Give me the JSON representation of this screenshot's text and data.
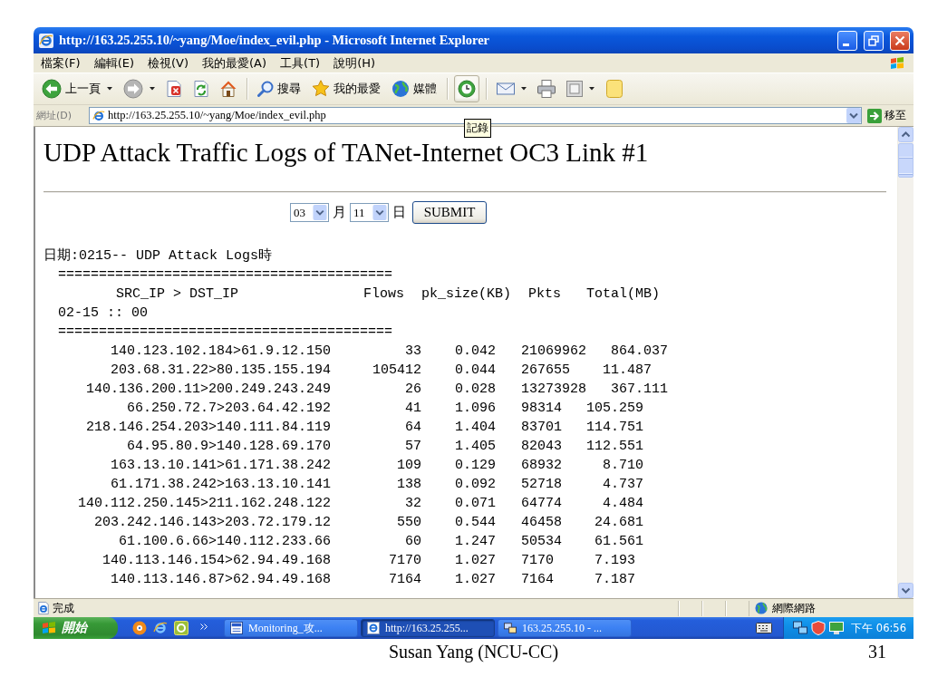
{
  "window": {
    "title": "http://163.25.255.10/~yang/Moe/index_evil.php - Microsoft Internet Explorer"
  },
  "menu_bar": {
    "items": [
      "檔案(F)",
      "編輯(E)",
      "檢視(V)",
      "我的最愛(A)",
      "工具(T)",
      "說明(H)"
    ]
  },
  "toolbar": {
    "items": [
      {
        "kind": "back",
        "label": "上一頁",
        "dropdown": true,
        "disabled": false,
        "hovered": false
      },
      {
        "kind": "forward",
        "dropdown": true,
        "disabled": true,
        "hovered": false
      },
      {
        "kind": "stop",
        "dropdown": false,
        "disabled": false,
        "hovered": false
      },
      {
        "kind": "refresh",
        "dropdown": false,
        "disabled": false,
        "hovered": false
      },
      {
        "kind": "home",
        "dropdown": false,
        "disabled": false,
        "hovered": false
      },
      {
        "kind": "search",
        "label": "搜尋",
        "dropdown": false,
        "disabled": false,
        "hovered": false
      },
      {
        "kind": "favorites",
        "label": "我的最愛",
        "dropdown": false,
        "disabled": false,
        "hovered": false
      },
      {
        "kind": "media",
        "label": "媒體",
        "dropdown": false,
        "disabled": false,
        "hovered": false
      },
      {
        "kind": "history",
        "dropdown": false,
        "disabled": false,
        "hovered": true
      },
      {
        "kind": "mail",
        "dropdown": true,
        "disabled": false,
        "hovered": false
      },
      {
        "kind": "print",
        "dropdown": false,
        "disabled": false,
        "hovered": false
      },
      {
        "kind": "edit",
        "dropdown": true,
        "disabled": false,
        "hovered": false
      },
      {
        "kind": "messenger",
        "dropdown": false,
        "disabled": false,
        "hovered": false
      }
    ]
  },
  "tooltip": "記錄",
  "address_bar": {
    "label": "網址(D)",
    "url": "http://163.25.255.10/~yang/Moe/index_evil.php",
    "go_button": "移至"
  },
  "page": {
    "heading": "UDP Attack Traffic Logs of TANet-Internet OC3 Link #1",
    "date_form": {
      "month": "03",
      "month_unit": "月",
      "day": "11",
      "day_unit": "日",
      "submit": "SUBMIT"
    },
    "log_title": "日期:0215-- UDP Attack Logs時",
    "log": {
      "separator_top": "=========================================",
      "columns": [
        "SRC_IP > DST_IP",
        "Flows",
        "pk_size(KB)",
        "Pkts",
        "Total(MB)"
      ],
      "hour": "02-15 :: 00",
      "separator_bottom": "=========================================",
      "rows": [
        {
          "src_dst": "140.123.102.184>61.9.12.150",
          "flows": "33",
          "pk_size": "0.042",
          "pkts": "21069962",
          "total": "864.037"
        },
        {
          "src_dst": "203.68.31.22>80.135.155.194",
          "flows": "105412",
          "pk_size": "0.044",
          "pkts": "267655",
          "total": "11.487"
        },
        {
          "src_dst": "140.136.200.11>200.249.243.249",
          "flows": "26",
          "pk_size": "0.028",
          "pkts": "13273928",
          "total": "367.111"
        },
        {
          "src_dst": "66.250.72.7>203.64.42.192",
          "flows": "41",
          "pk_size": "1.096",
          "pkts": "98314",
          "total": "105.259"
        },
        {
          "src_dst": "218.146.254.203>140.111.84.119",
          "flows": "64",
          "pk_size": "1.404",
          "pkts": "83701",
          "total": "114.751"
        },
        {
          "src_dst": "64.95.80.9>140.128.69.170",
          "flows": "57",
          "pk_size": "1.405",
          "pkts": "82043",
          "total": "112.551"
        },
        {
          "src_dst": "163.13.10.141>61.171.38.242",
          "flows": "109",
          "pk_size": "0.129",
          "pkts": "68932",
          "total": "8.710"
        },
        {
          "src_dst": "61.171.38.242>163.13.10.141",
          "flows": "138",
          "pk_size": "0.092",
          "pkts": "52718",
          "total": "4.737"
        },
        {
          "src_dst": "140.112.250.145>211.162.248.122",
          "flows": "32",
          "pk_size": "0.071",
          "pkts": "64774",
          "total": "4.484"
        },
        {
          "src_dst": "203.242.146.143>203.72.179.12",
          "flows": "550",
          "pk_size": "0.544",
          "pkts": "46458",
          "total": "24.681"
        },
        {
          "src_dst": "61.100.6.66>140.112.233.66",
          "flows": "60",
          "pk_size": "1.247",
          "pkts": "50534",
          "total": "61.561"
        },
        {
          "src_dst": "140.113.146.154>62.94.49.168",
          "flows": "7170",
          "pk_size": "1.027",
          "pkts": "7170",
          "total": "7.193"
        },
        {
          "src_dst": "140.113.146.87>62.94.49.168",
          "flows": "7164",
          "pk_size": "1.027",
          "pkts": "7164",
          "total": "7.187"
        }
      ]
    }
  },
  "status_bar": {
    "status": "完成",
    "zone": "網際網路"
  },
  "taskbar": {
    "start": "開始",
    "tasks": [
      {
        "kind": "document",
        "label": "Monitoring_攻...",
        "selected": false
      },
      {
        "kind": "browser",
        "label": "http://163.25.255...",
        "selected": true
      },
      {
        "kind": "terminal",
        "label": "163.25.255.10 - ...",
        "selected": false
      }
    ],
    "clock": "下午 06:56"
  },
  "footer": {
    "author": "Susan Yang (NCU-CC)",
    "page_number": "31"
  }
}
